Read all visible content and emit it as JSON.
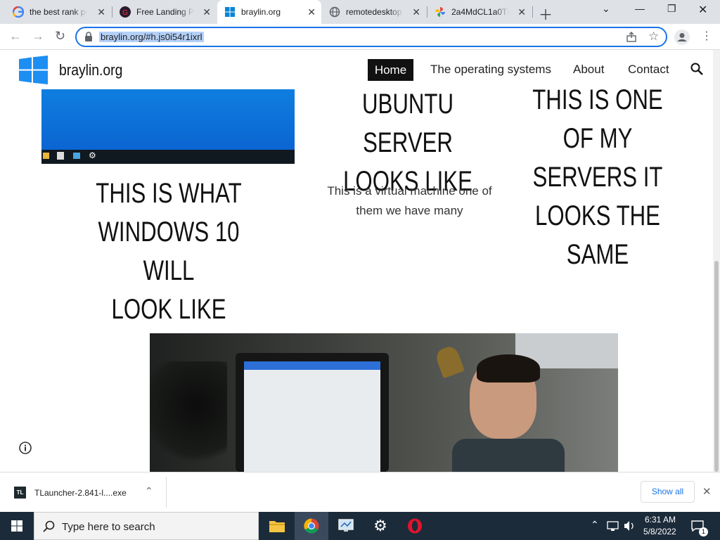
{
  "browser": {
    "tabs": [
      {
        "title": "the best rank pe",
        "icon": "google-icon"
      },
      {
        "title": "Free Landing Pa",
        "icon": "landing-icon"
      },
      {
        "title": "braylin.org",
        "icon": "windows-icon"
      },
      {
        "title": "remotedesktop",
        "icon": "globe-icon"
      },
      {
        "title": "2a4MdCL1a0Tn",
        "icon": "pinwheel-icon"
      }
    ],
    "url": "braylin.org/#h.js0i54r1ixrl"
  },
  "site": {
    "name": "braylin.org",
    "nav": [
      "Home",
      "The operating systems",
      "About",
      "Contact"
    ],
    "accent": "#111111"
  },
  "content": {
    "windows_headline": [
      "THIS IS WHAT",
      "WINDOWS 10 WILL",
      "LOOK LIKE"
    ],
    "ubuntu_headline": [
      "UBUNTU SERVER",
      "LOOKS LIKE"
    ],
    "ubuntu_desc": [
      "This is a virtual machine one of",
      "them we have many"
    ],
    "server_headline": [
      "THIS IS ONE",
      "OF MY",
      "SERVERS IT",
      "LOOKS THE",
      "SAME"
    ]
  },
  "downloads": {
    "file": "TLauncher-2.841-l....exe",
    "file_icon_label": "TL",
    "show_all": "Show all"
  },
  "taskbar": {
    "search_placeholder": "Type here to search",
    "time": "6:31 AM",
    "date": "5/8/2022",
    "notification_count": "1"
  }
}
